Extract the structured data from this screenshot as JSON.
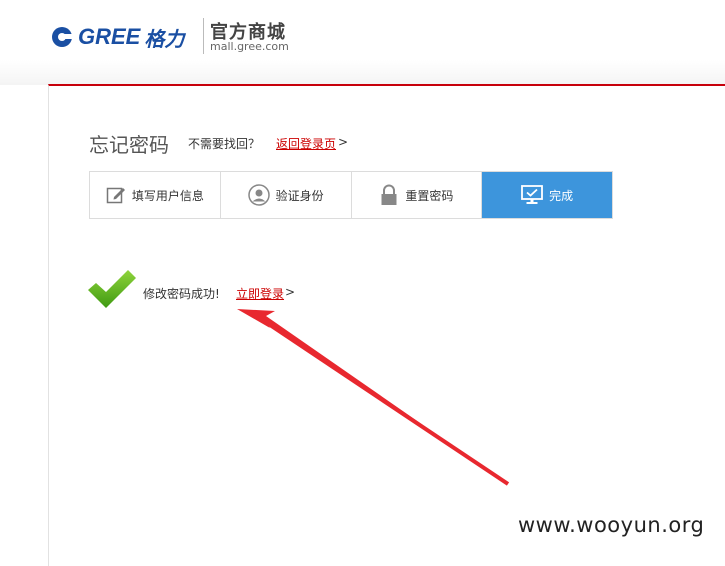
{
  "header": {
    "brand": "GREE",
    "brand_script": "格力",
    "mall_title": "官方商城",
    "mall_url": "mall.gree.com",
    "brand_color": "#1a4fa3"
  },
  "page": {
    "title": "忘记密码",
    "no_need_text": "不需要找回？",
    "back_link": "返回登录页",
    "back_suffix": ">",
    "accent_color": "#c7000b"
  },
  "steps": [
    {
      "label": "填写用户信息",
      "icon": "edit-icon",
      "active": false
    },
    {
      "label": "验证身份",
      "icon": "user-icon",
      "active": false
    },
    {
      "label": "重置密码",
      "icon": "lock-icon",
      "active": false
    },
    {
      "label": "完成",
      "icon": "monitor-check-icon",
      "active": true
    }
  ],
  "success": {
    "message": "修改密码成功!",
    "login_link": "立即登录",
    "login_suffix": ">",
    "icon": "checkmark-icon"
  },
  "watermark": "www.wooyun.org",
  "colors": {
    "step_active": "#3d95dc",
    "check_green": "#5cb51c",
    "arrow_red": "#e8282f",
    "link_red": "#cc0000"
  }
}
